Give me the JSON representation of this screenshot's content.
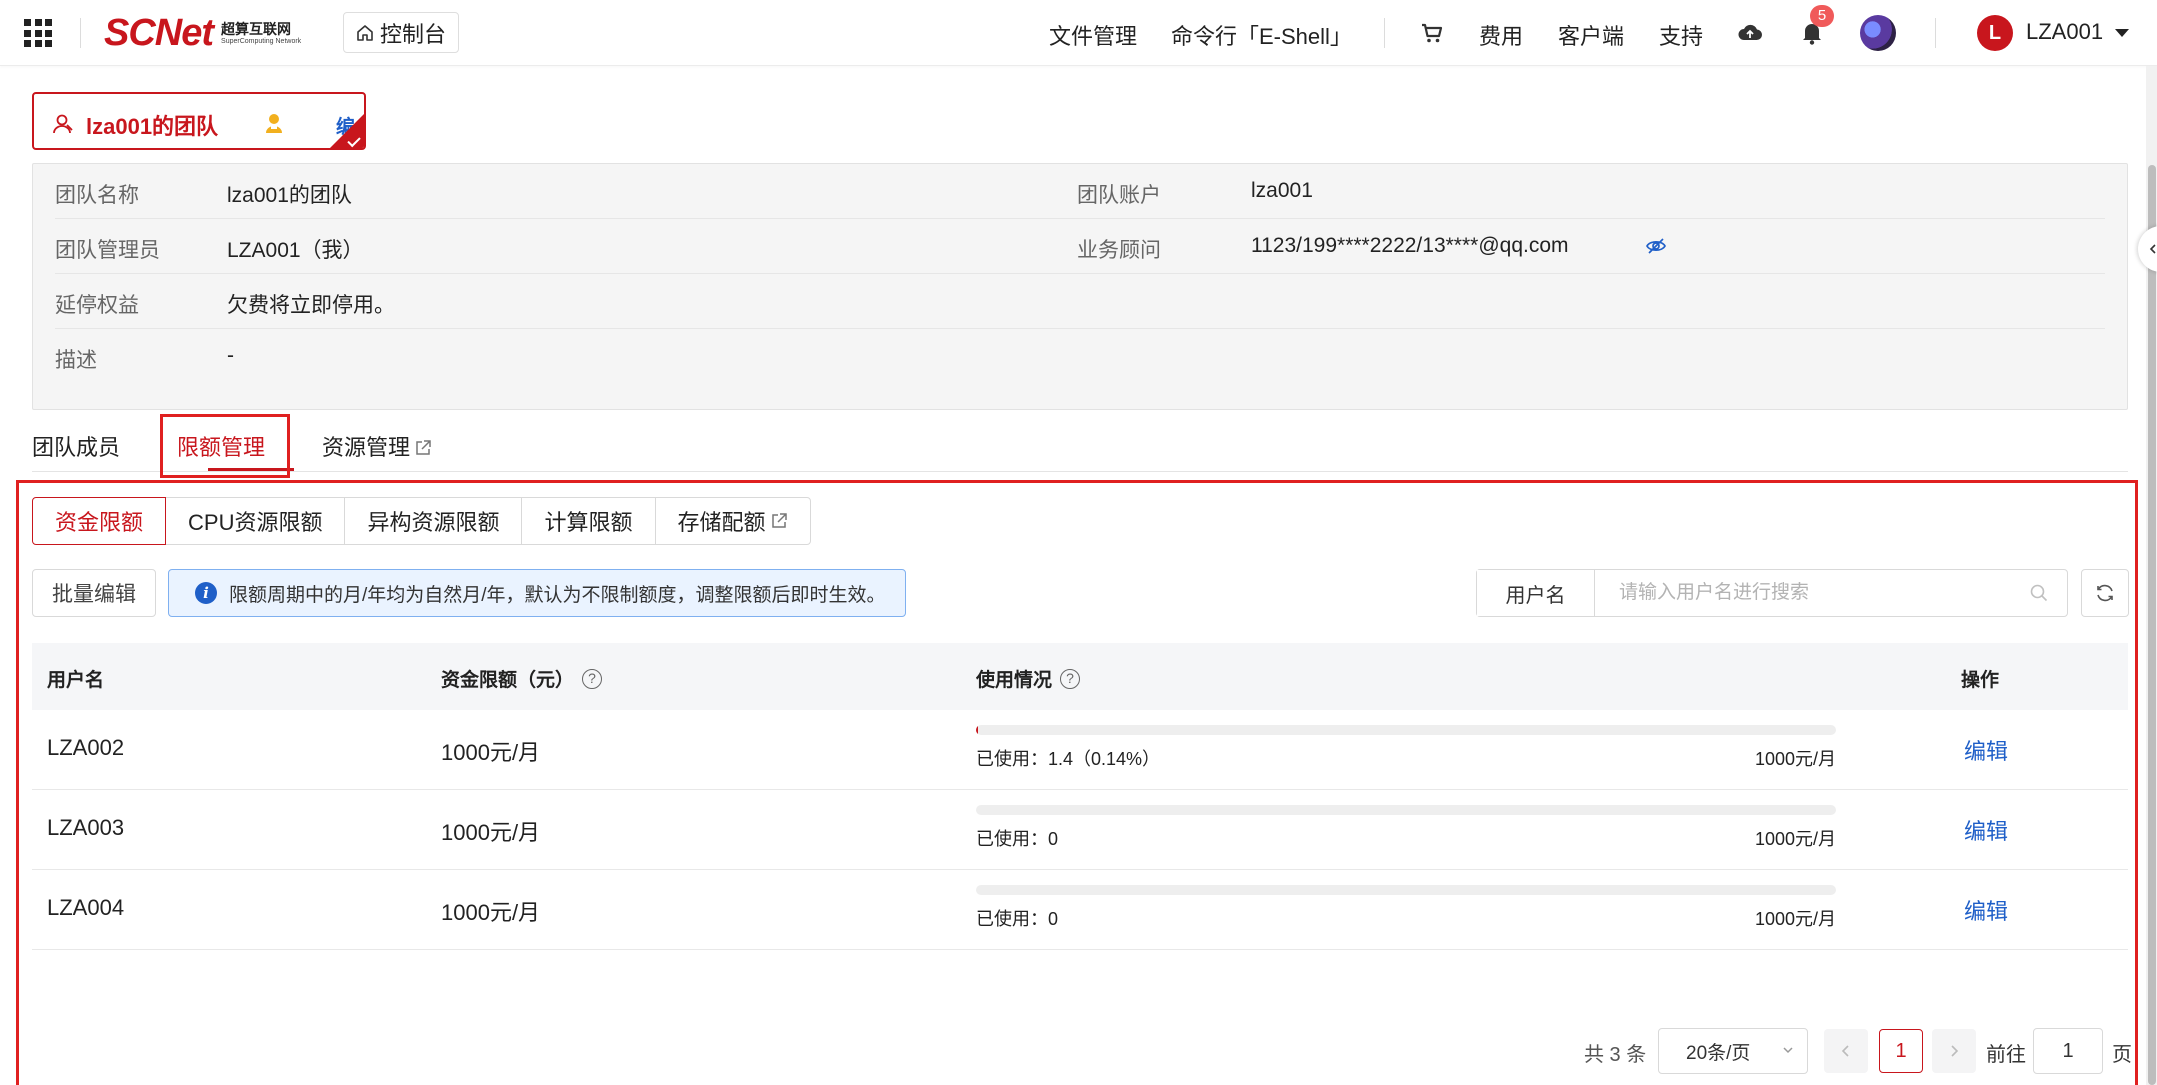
{
  "topbar": {
    "logo_word": "SCNet",
    "logo_cn": "超算互联网",
    "logo_en": "SuperComputing Network",
    "console_label": "控制台",
    "nav": [
      "文件管理",
      "命令行「E-Shell」",
      "费用",
      "客户端",
      "支持"
    ],
    "notification_count": "5",
    "user_initial": "L",
    "user_name": "LZA001"
  },
  "team": {
    "chip_name": "lza001的团队",
    "chip_edit": "编辑",
    "fields": [
      {
        "label": "团队名称",
        "value": "lza001的团队",
        "label2": "团队账户",
        "value2": "lza001"
      },
      {
        "label": "团队管理员",
        "value": "LZA001（我）",
        "label2": "业务顾问",
        "value2": "1123/199****2222/13****@qq.com"
      },
      {
        "label": "延停权益",
        "value": "欠费将立即停用。"
      },
      {
        "label": "描述",
        "value": "-"
      }
    ]
  },
  "tabs": {
    "members": "团队成员",
    "quota": "限额管理",
    "resources": "资源管理"
  },
  "subtabs": [
    "资金限额",
    "CPU资源限额",
    "异构资源限额",
    "计算限额",
    "存储配额"
  ],
  "toolbar": {
    "batch_edit": "批量编辑",
    "notice": "限额周期中的月/年均为自然月/年，默认为不限制额度，调整限额后即时生效。",
    "search_label": "用户名",
    "search_placeholder": "请输入用户名进行搜索"
  },
  "table": {
    "headers": {
      "user": "用户名",
      "limit": "资金限额（元）",
      "usage": "使用情况",
      "action": "操作"
    },
    "rows": [
      {
        "user": "LZA002",
        "limit": "1000元/月",
        "used_text": "已使用：1.4（0.14%）",
        "max_text": "1000元/月",
        "usage_percent": 0.14,
        "action": "编辑"
      },
      {
        "user": "LZA003",
        "limit": "1000元/月",
        "used_text": "已使用：0",
        "max_text": "1000元/月",
        "usage_percent": 0,
        "action": "编辑"
      },
      {
        "user": "LZA004",
        "limit": "1000元/月",
        "used_text": "已使用：0",
        "max_text": "1000元/月",
        "usage_percent": 0,
        "action": "编辑"
      }
    ]
  },
  "pagination": {
    "total": "共 3 条",
    "page_size": "20条/页",
    "current_page": "1",
    "goto_label": "前往",
    "goto_value": "1",
    "goto_suffix": "页"
  },
  "colors": {
    "brand_red": "#c8161d",
    "link_blue": "#1f5fc8",
    "highlight_red": "#e02020"
  }
}
